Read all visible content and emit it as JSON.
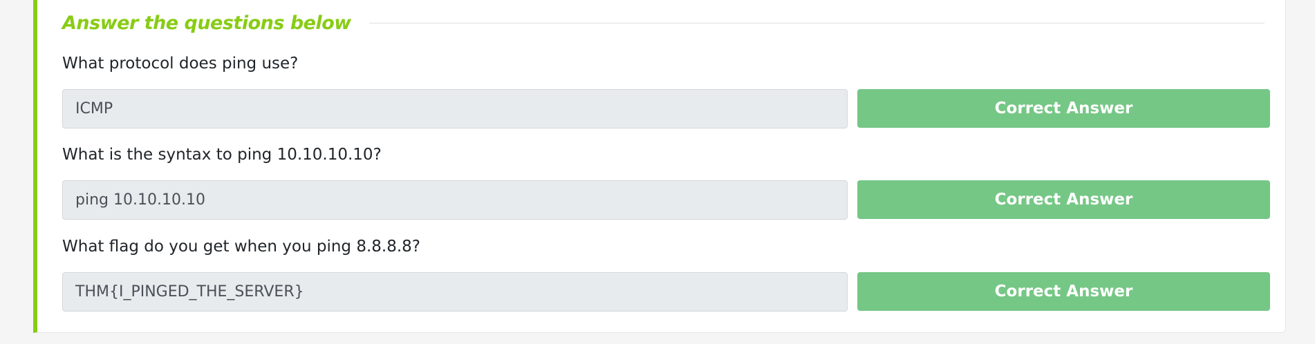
{
  "section": {
    "heading": "Answer the questions below"
  },
  "questions": [
    {
      "question": "What protocol does ping use?",
      "answer": "ICMP",
      "button_label": "Correct Answer"
    },
    {
      "question": "What is the syntax to ping 10.10.10.10?",
      "answer": "ping 10.10.10.10",
      "button_label": "Correct Answer"
    },
    {
      "question": "What flag do you get when you ping 8.8.8.8?",
      "answer": "THM{I_PINGED_THE_SERVER}",
      "button_label": "Correct Answer"
    }
  ],
  "colors": {
    "accent": "#88cc14",
    "correct_button": "#75c785",
    "answer_field_bg": "#e8ebee",
    "page_bg": "#f5f5f5"
  }
}
